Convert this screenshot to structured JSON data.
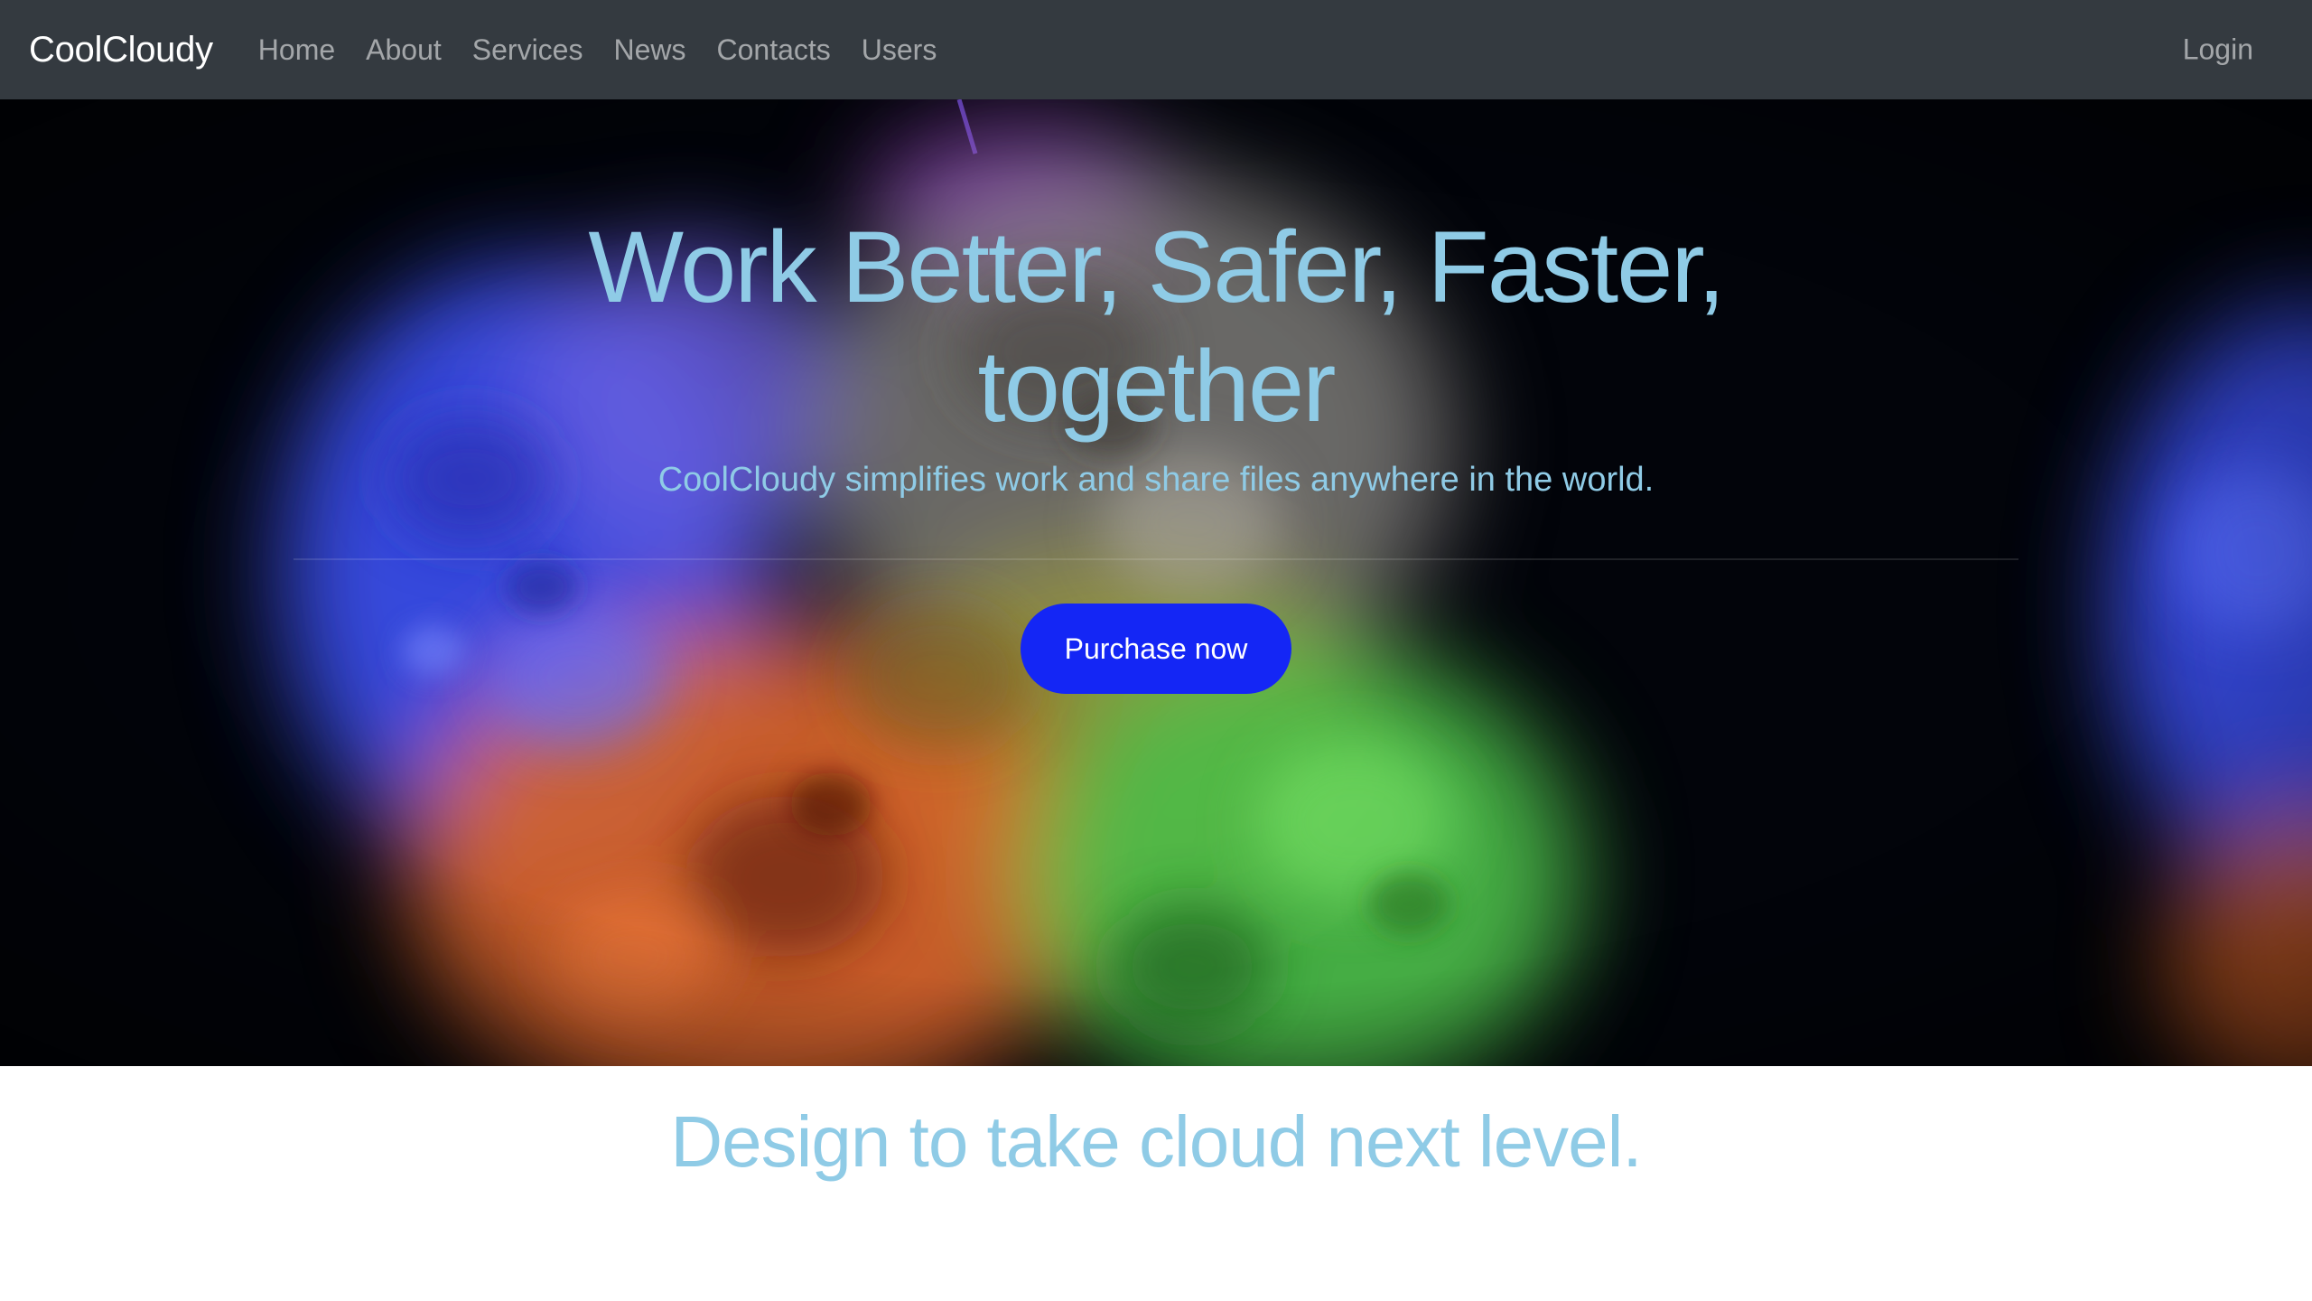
{
  "navbar": {
    "brand": "CoolCloudy",
    "links": [
      {
        "label": "Home"
      },
      {
        "label": "About"
      },
      {
        "label": "Services"
      },
      {
        "label": "News"
      },
      {
        "label": "Contacts"
      },
      {
        "label": "Users"
      }
    ],
    "login_label": "Login"
  },
  "hero": {
    "title_line1": "Work Better, Safer, Faster,",
    "title_line2": "together",
    "subtitle": "CoolCloudy simplifies work and share files anywhere in the world.",
    "cta_label": "Purchase now",
    "background_image": "colorful-smoke-clouds",
    "colors": {
      "text": "#8fcbe6",
      "button": "#1426f5",
      "background": "#02040a"
    }
  },
  "section": {
    "title": "Design to take cloud next level."
  },
  "theme": {
    "navbar_bg": "#343a40"
  }
}
